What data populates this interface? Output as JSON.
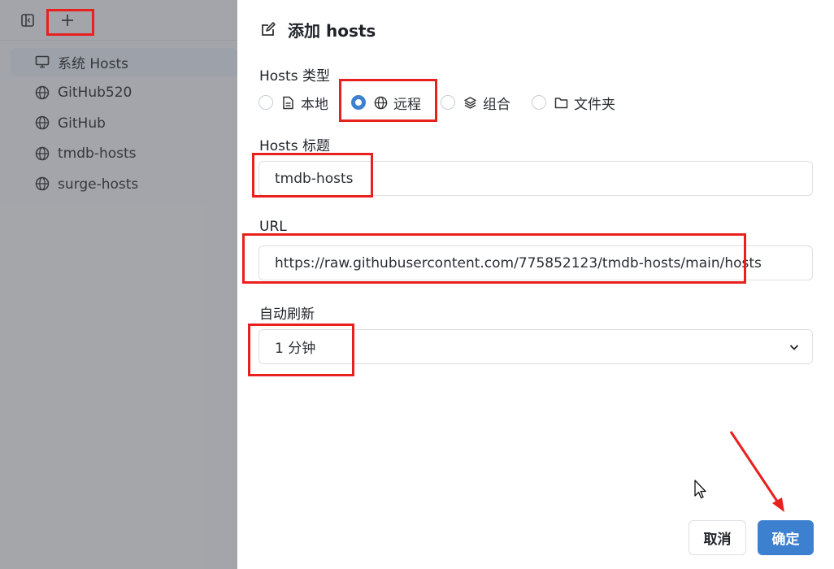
{
  "sidebar": {
    "toolbar": {
      "toggle_icon": "sidebar-toggle-icon",
      "add_icon": "plus-icon"
    },
    "hosts": [
      {
        "label": "系统 Hosts",
        "icon": "monitor-icon",
        "active": true
      },
      {
        "label": "GitHub520",
        "icon": "globe-icon",
        "active": false
      },
      {
        "label": "GitHub",
        "icon": "globe-icon",
        "active": false
      },
      {
        "label": "tmdb-hosts",
        "icon": "globe-icon",
        "active": false
      },
      {
        "label": "surge-hosts",
        "icon": "globe-icon",
        "active": false
      }
    ]
  },
  "form": {
    "title": "添加 hosts",
    "type_label": "Hosts 类型",
    "types": [
      {
        "label": "本地",
        "icon": "file-icon",
        "checked": false
      },
      {
        "label": "远程",
        "icon": "globe-icon",
        "checked": true
      },
      {
        "label": "组合",
        "icon": "layers-icon",
        "checked": false
      },
      {
        "label": "文件夹",
        "icon": "folder-icon",
        "checked": false
      }
    ],
    "title_label": "Hosts 标题",
    "title_value": "tmdb-hosts",
    "url_label": "URL",
    "url_value": "https://raw.githubusercontent.com/775852123/tmdb-hosts/main/hosts",
    "refresh_label": "自动刷新",
    "refresh_value": "1 分钟",
    "cancel_label": "取消",
    "ok_label": "确定"
  },
  "colors": {
    "accent": "#3c80cf",
    "annotation": "#e8201e"
  }
}
